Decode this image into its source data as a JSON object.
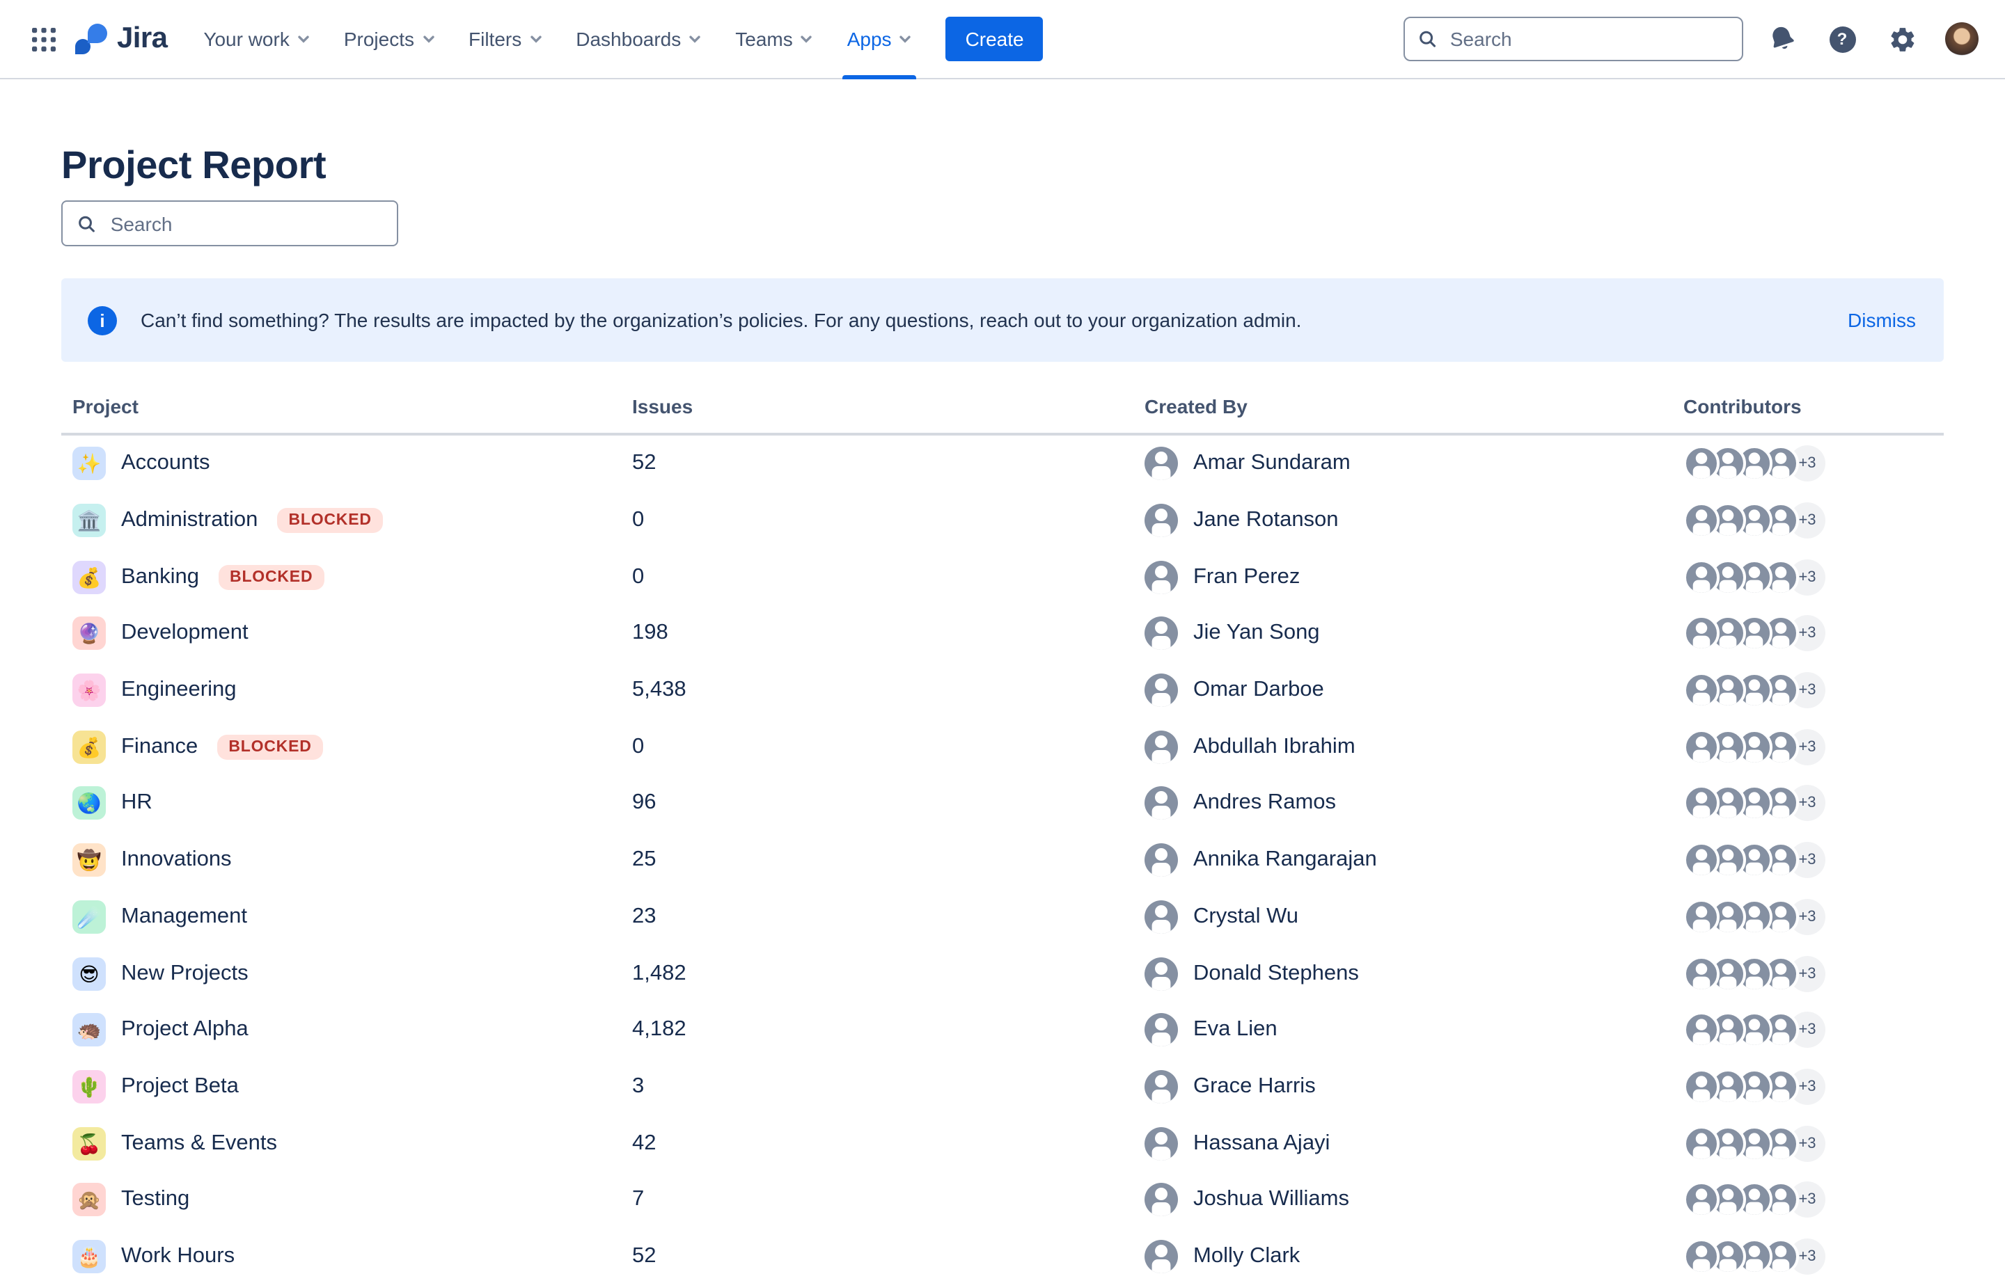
{
  "header": {
    "product": "Jira",
    "nav": [
      {
        "label": "Your work",
        "active": false
      },
      {
        "label": "Projects",
        "active": false
      },
      {
        "label": "Filters",
        "active": false
      },
      {
        "label": "Dashboards",
        "active": false
      },
      {
        "label": "Teams",
        "active": false
      },
      {
        "label": "Apps",
        "active": true
      }
    ],
    "create_label": "Create",
    "search_placeholder": "Search",
    "icons": [
      "app-switcher-icon",
      "search-icon",
      "notifications-icon",
      "help-icon",
      "settings-icon",
      "user-avatar"
    ]
  },
  "page": {
    "title": "Project Report",
    "search_placeholder": "Search",
    "banner": {
      "icon": "info-icon",
      "icon_glyph": "i",
      "text": "Can’t find something? The results are impacted by the organization’s policies. For any questions, reach out to your organization admin.",
      "dismiss_label": "Dismiss"
    }
  },
  "table": {
    "columns": [
      "Project",
      "Issues",
      "Created By",
      "Contributors"
    ],
    "badge_label": "BLOCKED",
    "contributors_count": 4,
    "contributors_overflow": "+3",
    "rows": [
      {
        "project": "Accounts",
        "emoji": "✨",
        "tile_color": "#cfe1fd",
        "blocked": false,
        "issues": "52",
        "created_by": "Amar Sundaram"
      },
      {
        "project": "Administration",
        "emoji": "🏛️",
        "tile_color": "#c6f0ef",
        "blocked": true,
        "issues": "0",
        "created_by": "Jane Rotanson"
      },
      {
        "project": "Banking",
        "emoji": "💰",
        "tile_color": "#dfd8fd",
        "blocked": true,
        "issues": "0",
        "created_by": "Fran Perez"
      },
      {
        "project": "Development",
        "emoji": "🔮",
        "tile_color": "#ffd5d2",
        "blocked": false,
        "issues": "198",
        "created_by": "Jie Yan Song"
      },
      {
        "project": "Engineering",
        "emoji": "🌸",
        "tile_color": "#fcd2ec",
        "blocked": false,
        "issues": "5,438",
        "created_by": "Omar Darboe"
      },
      {
        "project": "Finance",
        "emoji": "💰",
        "tile_color": "#f7e394",
        "blocked": true,
        "issues": "0",
        "created_by": "Abdullah Ibrahim"
      },
      {
        "project": "HR",
        "emoji": "🌏",
        "tile_color": "#bdf2d7",
        "blocked": false,
        "issues": "96",
        "created_by": "Andres Ramos"
      },
      {
        "project": "Innovations",
        "emoji": "🤠",
        "tile_color": "#ffe3c8",
        "blocked": false,
        "issues": "25",
        "created_by": "Annika Rangarajan"
      },
      {
        "project": "Management",
        "emoji": "☄️",
        "tile_color": "#bdf2d7",
        "blocked": false,
        "issues": "23",
        "created_by": "Crystal Wu"
      },
      {
        "project": "New Projects",
        "emoji": "😎",
        "tile_color": "#cfe1fd",
        "blocked": false,
        "issues": "1,482",
        "created_by": "Donald Stephens"
      },
      {
        "project": "Project Alpha",
        "emoji": "🦔",
        "tile_color": "#cfe1fd",
        "blocked": false,
        "issues": "4,182",
        "created_by": "Eva Lien"
      },
      {
        "project": "Project Beta",
        "emoji": "🌵",
        "tile_color": "#fcd2ec",
        "blocked": false,
        "issues": "3",
        "created_by": "Grace Harris"
      },
      {
        "project": "Teams & Events",
        "emoji": "🍒",
        "tile_color": "#f3ea9f",
        "blocked": false,
        "issues": "42",
        "created_by": "Hassana Ajayi"
      },
      {
        "project": "Testing",
        "emoji": "🙊",
        "tile_color": "#ffd5d2",
        "blocked": false,
        "issues": "7",
        "created_by": "Joshua Williams"
      },
      {
        "project": "Work Hours",
        "emoji": "🎂",
        "tile_color": "#cfe1fd",
        "blocked": false,
        "issues": "52",
        "created_by": "Molly Clark"
      }
    ]
  },
  "colors": {
    "accent": "#0c66e4",
    "text_primary": "#172b4d",
    "text_secondary": "#44546f",
    "banner_bg": "#e9f1fe",
    "blocked_bg": "#ffe2dd",
    "blocked_text": "#b23029",
    "avatar_gray": "#8590a2",
    "header_border": "#d5d9e0"
  }
}
